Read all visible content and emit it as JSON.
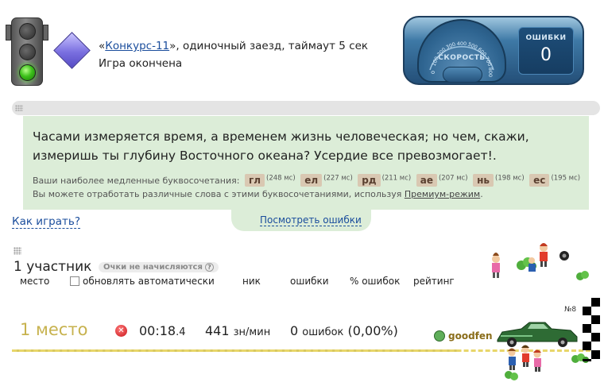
{
  "header": {
    "race_prefix": "«",
    "race_link": "Конкурс-11",
    "race_suffix": "», одиночный заезд, таймаут 5 сек",
    "status": "Игра окончена"
  },
  "dashboard": {
    "speed_label": "СКОРОСТЬ",
    "ticks": [
      "0",
      "100",
      "200",
      "300",
      "400",
      "500",
      "600",
      "700",
      "800"
    ],
    "errors_label": "ОШИБКИ",
    "errors_value": "0"
  },
  "text_panel": {
    "text": "Часами измеряется время, а временем жизнь человеческая; но чем, скажи, измеришь ты глубину Восточного океана? Усердие все превозмогает!.",
    "slow_label": "Ваши наиболее медленные буквосочетания:",
    "slow_combos": [
      {
        "combo": "гл",
        "ms": "(248 мс)"
      },
      {
        "combo": "ел",
        "ms": "(227 мс)"
      },
      {
        "combo": "рд",
        "ms": "(211 мс)"
      },
      {
        "combo": "ае",
        "ms": "(207 мс)"
      },
      {
        "combo": "нь",
        "ms": "(198 мс)"
      },
      {
        "combo": "ес",
        "ms": "(195 мс)"
      }
    ],
    "hint_text": "Вы можете отработать различные слова с этими буквосочетаниями, используя ",
    "hint_link": "Премиум-режим",
    "hint_end": ".",
    "errors_link": "Посмотреть ошибки"
  },
  "how_to_play": "Как играть?",
  "participants": {
    "count": "1 участник",
    "no_points": "Очки не начисляются",
    "help": "?",
    "columns": {
      "place": "место",
      "auto_update": "обновлять автоматически",
      "nick": "ник",
      "errors": "ошибки",
      "error_pct": "% ошибок",
      "rating": "рейтинг"
    }
  },
  "result": {
    "place": "1 место",
    "time_main": "00:18",
    "time_frac": ".4",
    "speed": "441",
    "speed_unit": "зн/мин",
    "errors": "0",
    "errors_unit": "ошибок",
    "pct": "(0,00%)",
    "nick": "goodfen",
    "car_number": "№8"
  },
  "colors": {
    "link": "#1a4d9c",
    "panel_bg": "#dcedd8",
    "place": "#c7b24e",
    "track": "#e8d66a",
    "car": "#2e6b34"
  }
}
